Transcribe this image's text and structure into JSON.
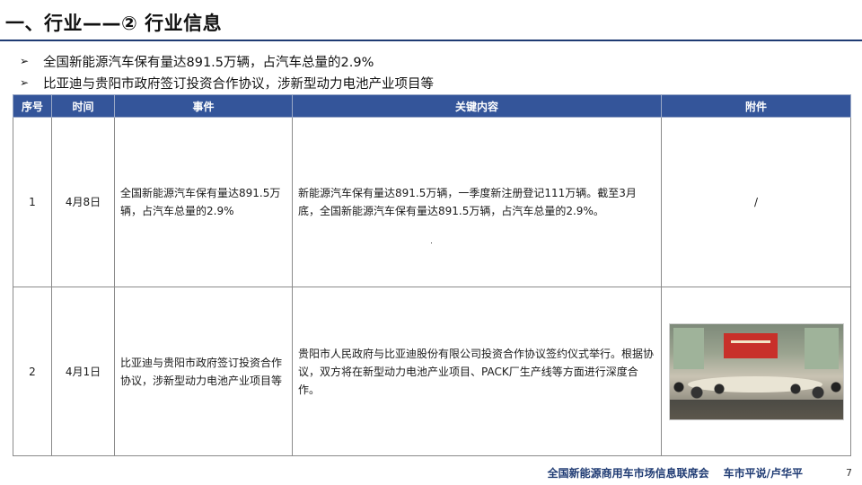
{
  "header": {
    "title": "一、行业——② 行业信息"
  },
  "bullets": [
    "全国新能源汽车保有量达891.5万辆，占汽车总量的2.9%",
    "比亚迪与贵阳市政府签订投资合作协议，涉新型动力电池产业项目等"
  ],
  "table": {
    "headers": [
      "序号",
      "时间",
      "事件",
      "关键内容",
      "附件"
    ],
    "rows": [
      {
        "no": "1",
        "date": "4月8日",
        "event": "全国新能源汽车保有量达891.5万辆，占汽车总量的2.9%",
        "content": "新能源汽车保有量达891.5万辆，一季度新注册登记111万辆。截至3月底，全国新能源汽车保有量达891.5万辆，占汽车总量的2.9%。",
        "attachment": "/"
      },
      {
        "no": "2",
        "date": "4月1日",
        "event": "比亚迪与贵阳市政府签订投资合作协议，涉新型动力电池产业项目等",
        "content": "贵阳市人民政府与比亚迪股份有限公司投资合作协议签约仪式举行。根据协议，双方将在新型动力电池产业项目、PACK厂生产线等方面进行深度合作。",
        "attachment": ""
      }
    ]
  },
  "footer": {
    "org": "全国新能源商用车市场信息联席会",
    "author": "车市平说/卢华平",
    "page": "7"
  },
  "colors": {
    "accent": "#1f3b73",
    "table_header": "#34559a"
  }
}
